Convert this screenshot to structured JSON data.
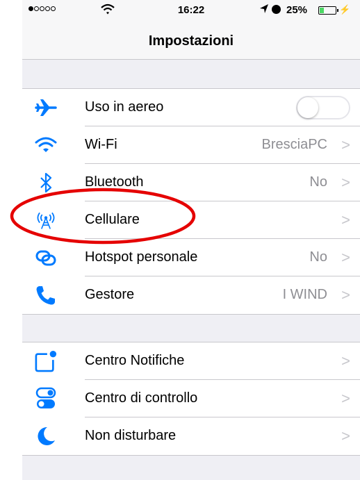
{
  "status_bar": {
    "signal_bars_filled": 1,
    "signal_bars_total": 5,
    "time": "16:22",
    "battery_percent": "25%",
    "icons": [
      "signal-dots-icon",
      "wifi-icon",
      "location-arrow-icon",
      "alarm-icon",
      "battery-icon",
      "charging-bolt-icon"
    ]
  },
  "nav": {
    "title": "Impostazioni"
  },
  "groups": [
    {
      "rows": [
        {
          "label": "Uso in aereo",
          "icon": "airplane-icon",
          "toggle_on": false
        },
        {
          "label": "Wi-Fi",
          "icon": "wifi-icon",
          "value": "BresciaPC"
        },
        {
          "label": "Bluetooth",
          "icon": "bluetooth-icon",
          "value": "No"
        },
        {
          "label": "Cellulare",
          "icon": "cellular-antenna-icon",
          "value": ""
        },
        {
          "label": "Hotspot personale",
          "icon": "hotspot-link-icon",
          "value": "No"
        },
        {
          "label": "Gestore",
          "icon": "phone-icon",
          "value": "I WIND"
        }
      ]
    },
    {
      "rows": [
        {
          "label": "Centro Notifiche",
          "icon": "notification-center-icon"
        },
        {
          "label": "Centro di controllo",
          "icon": "control-center-icon"
        },
        {
          "label": "Non disturbare",
          "icon": "moon-icon"
        }
      ]
    }
  ],
  "chevron": ">",
  "colors": {
    "accent": "#007aff",
    "highlight_annotation": "#e50000",
    "background": "#efeff4",
    "secondary_text": "#8e8e93"
  }
}
